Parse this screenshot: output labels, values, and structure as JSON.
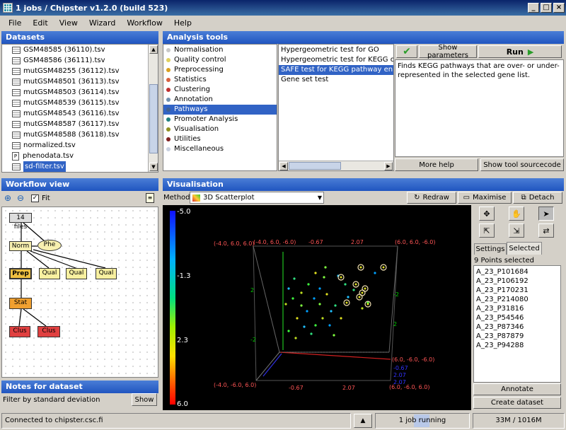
{
  "window": {
    "title": "1 jobs / Chipster v1.2.0 (build 523)",
    "min": "_",
    "max": "□",
    "close": "×"
  },
  "menu": [
    "File",
    "Edit",
    "View",
    "Wizard",
    "Workflow",
    "Help"
  ],
  "datasets": {
    "title": "Datasets",
    "items": [
      {
        "label": "GSM48585 (36110).tsv",
        "icon": "table-icon"
      },
      {
        "label": "GSM48586 (36111).tsv",
        "icon": "table-icon"
      },
      {
        "label": "mutGSM48255 (36112).tsv",
        "icon": "table-icon"
      },
      {
        "label": "mutGSM48501 (36113).tsv",
        "icon": "table-icon"
      },
      {
        "label": "mutGSM48503 (36114).tsv",
        "icon": "table-icon"
      },
      {
        "label": "mutGSM48539 (36115).tsv",
        "icon": "table-icon"
      },
      {
        "label": "mutGSM48543 (36116).tsv",
        "icon": "table-icon"
      },
      {
        "label": "mutGSM48587 (36117).tsv",
        "icon": "table-icon"
      },
      {
        "label": "mutGSM48588 (36118).tsv",
        "icon": "table-icon"
      },
      {
        "label": "normalized.tsv",
        "icon": "table-icon"
      },
      {
        "label": "phenodata.tsv",
        "icon": "phenodata-icon"
      },
      {
        "label": "sd-filter.tsv",
        "icon": "table-icon",
        "selected": true
      }
    ]
  },
  "analysis": {
    "title": "Analysis tools",
    "categories": [
      {
        "label": "Normalisation",
        "color": "#c8c8c8"
      },
      {
        "label": "Quality control",
        "color": "#e0d060"
      },
      {
        "label": "Preprocessing",
        "color": "#d8a020"
      },
      {
        "label": "Statistics",
        "color": "#d86040"
      },
      {
        "label": "Clustering",
        "color": "#c03030"
      },
      {
        "label": "Annotation",
        "color": "#7090b0"
      },
      {
        "label": "Pathways",
        "color": "#406090",
        "selected": true
      },
      {
        "label": "Promoter Analysis",
        "color": "#208080"
      },
      {
        "label": "Visualisation",
        "color": "#909020"
      },
      {
        "label": "Utilities",
        "color": "#802020"
      },
      {
        "label": "Miscellaneous",
        "color": "#c8d0e0"
      }
    ],
    "tools": [
      {
        "label": "Hypergeometric test for GO"
      },
      {
        "label": "Hypergeometric test for KEGG or PFAM"
      },
      {
        "label": "SAFE test for KEGG pathway enrichme",
        "selected": true
      },
      {
        "label": "Gene set test"
      }
    ],
    "show_params": "Show parameters",
    "run": "Run",
    "description": "Finds KEGG pathways that are over- or under-represented in the selected gene list.",
    "more_help": "More help",
    "show_source": "Show tool sourcecode"
  },
  "workflow": {
    "title": "Workflow view",
    "fit": "Fit",
    "nodes": {
      "files": "14 files",
      "norm": "Norm",
      "phe": "Phe",
      "prep": "Prep",
      "qual1": "Qual",
      "qual2": "Qual",
      "qual3": "Qual",
      "stat": "Stat",
      "clus1": "Clus",
      "clus2": "Clus"
    }
  },
  "notes": {
    "title": "Notes for dataset",
    "text": "Filter by standard deviation",
    "show": "Show"
  },
  "vis": {
    "title": "Visualisation",
    "method_label": "Method:",
    "method": "3D Scatterplot",
    "redraw": "Redraw",
    "maximise": "Maximise",
    "detach": "Detach",
    "scale": {
      "top": "-5.0",
      "t1": "-1.3",
      "t2": "2.3",
      "bottom": "6.0"
    },
    "corners": {
      "c1": "(-4.0, 6.0, 6.0)",
      "c2": "(-4.0, 6.0, -6.0)",
      "c3": "(6.0, 6.0, -6.0)",
      "c4": "(6.0, -6.0, -6.0)",
      "c5": "(-4.0, -6.0, 6.0)",
      "c6": "(6.0, -6.0, 6.0)"
    },
    "ticks": {
      "a": "-0.67",
      "b": "2.07",
      "c": "2",
      "d": "-2",
      "e": "2.07",
      "f": "-0.67",
      "g": "2.07",
      "h": "2.07",
      "i": "-0.67",
      "j": "2",
      "k": "-2"
    },
    "tabs": {
      "settings": "Settings",
      "selected": "Selected"
    },
    "points_selected": "9 Points selected",
    "selected_list": [
      "A_23_P101684",
      "A_23_P106192",
      "A_23_P170231",
      "A_23_P214080",
      "A_23_P31816",
      "A_23_P54546",
      "A_23_P87346",
      "A_23_P87879",
      "A_23_P94288"
    ],
    "annotate": "Annotate",
    "create": "Create dataset"
  },
  "status": {
    "connected": "Connected to chipster.csc.fi",
    "jobs": "1 job running",
    "memory": "33M / 1016M"
  }
}
